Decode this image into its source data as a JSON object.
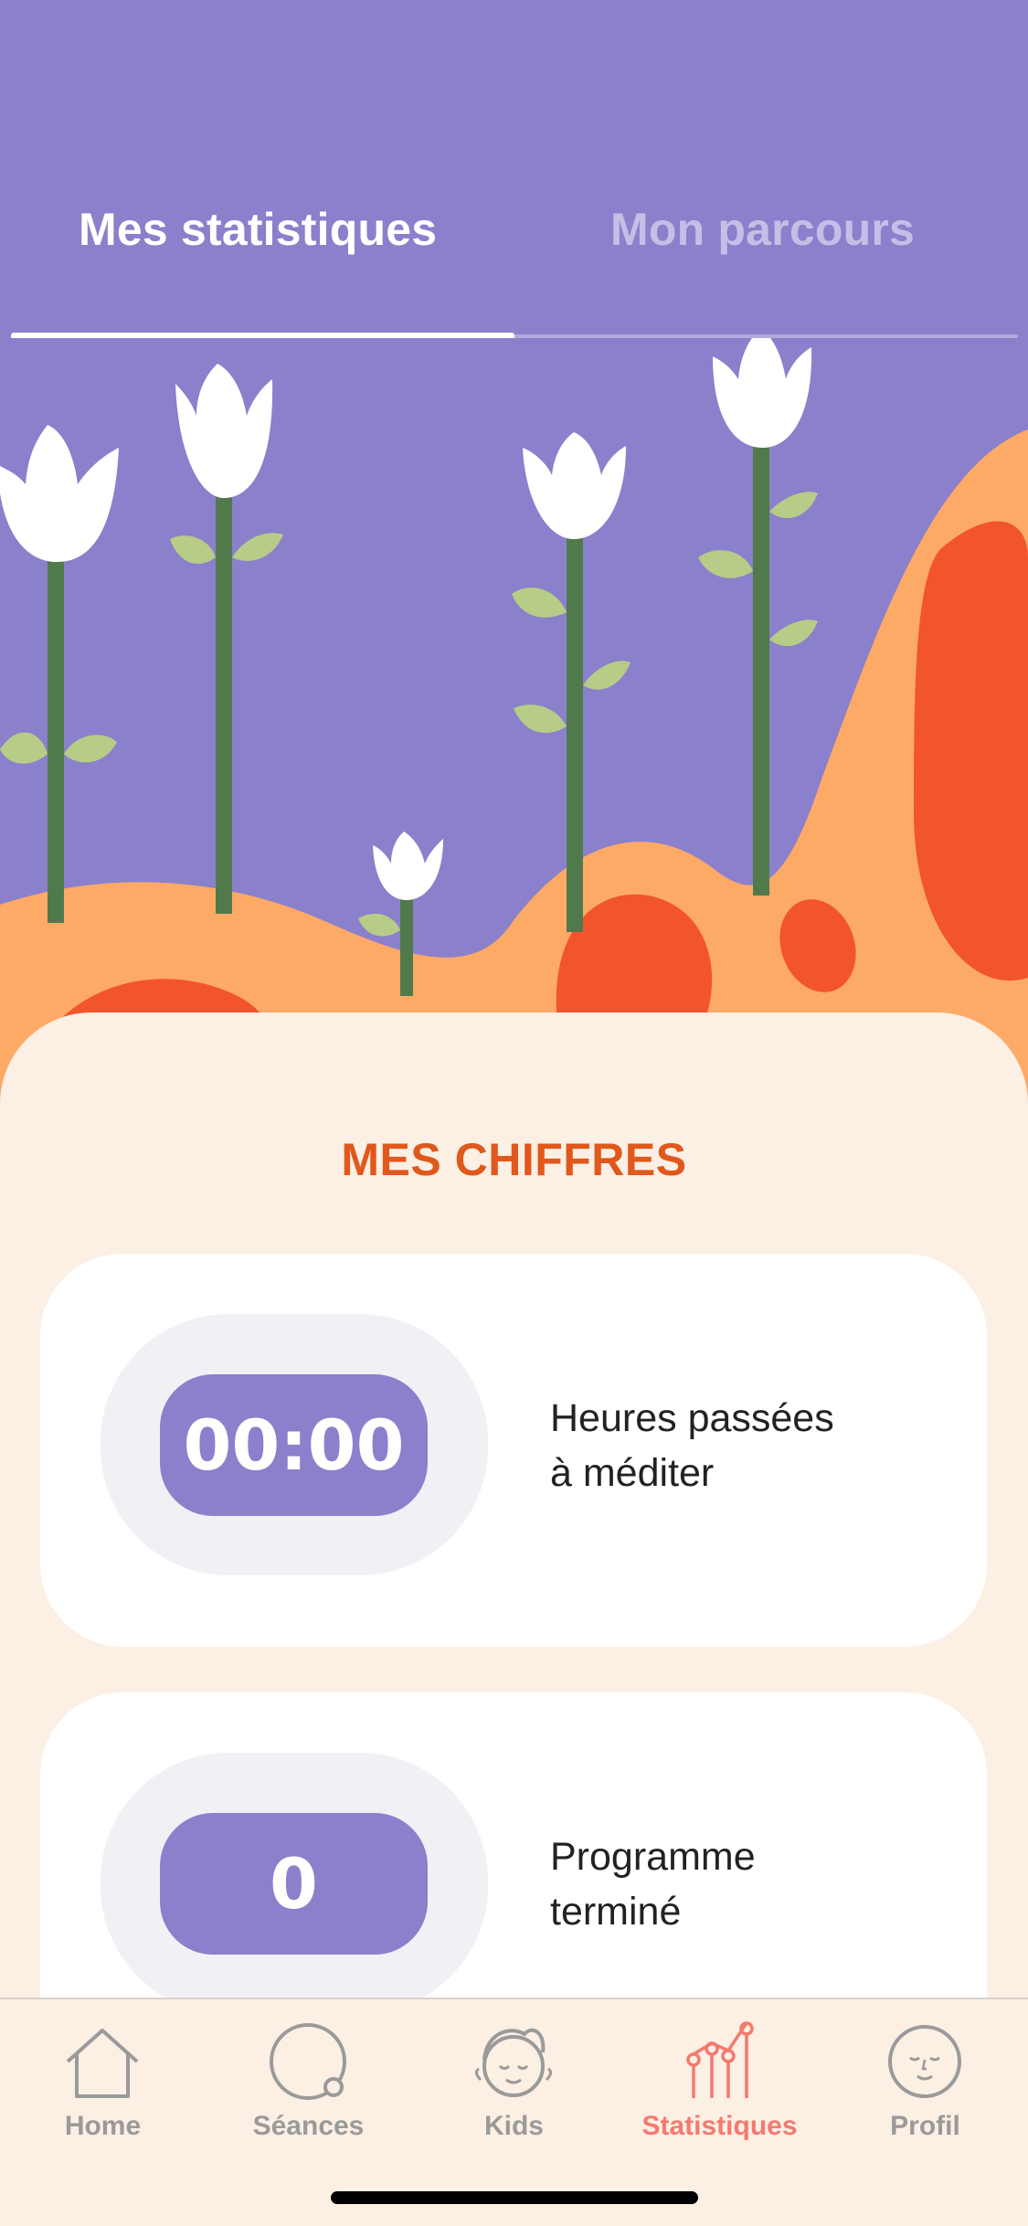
{
  "tabs": [
    {
      "label": "Mes statistiques",
      "active": true
    },
    {
      "label": "Mon parcours",
      "active": false
    }
  ],
  "section_title": "MES CHIFFRES",
  "stats": [
    {
      "value": "00:00",
      "label_line1": "Heures passées",
      "label_line2": "à méditer"
    },
    {
      "value": "0",
      "label_line1": "Programme",
      "label_line2": "terminé"
    }
  ],
  "nav": {
    "items": [
      {
        "label": "Home",
        "icon": "home-icon",
        "active": false
      },
      {
        "label": "Séances",
        "icon": "sessions-icon",
        "active": false
      },
      {
        "label": "Kids",
        "icon": "kid-face-icon",
        "active": false
      },
      {
        "label": "Statistiques",
        "icon": "stats-icon",
        "active": true
      },
      {
        "label": "Profil",
        "icon": "profile-face-icon",
        "active": false
      }
    ]
  },
  "colors": {
    "header_bg": "#8B80CB",
    "accent_orange": "#E0581B",
    "card_pill": "#8B80CB",
    "active_nav": "#F37A6F",
    "panel_bg": "#FCEFE4"
  }
}
